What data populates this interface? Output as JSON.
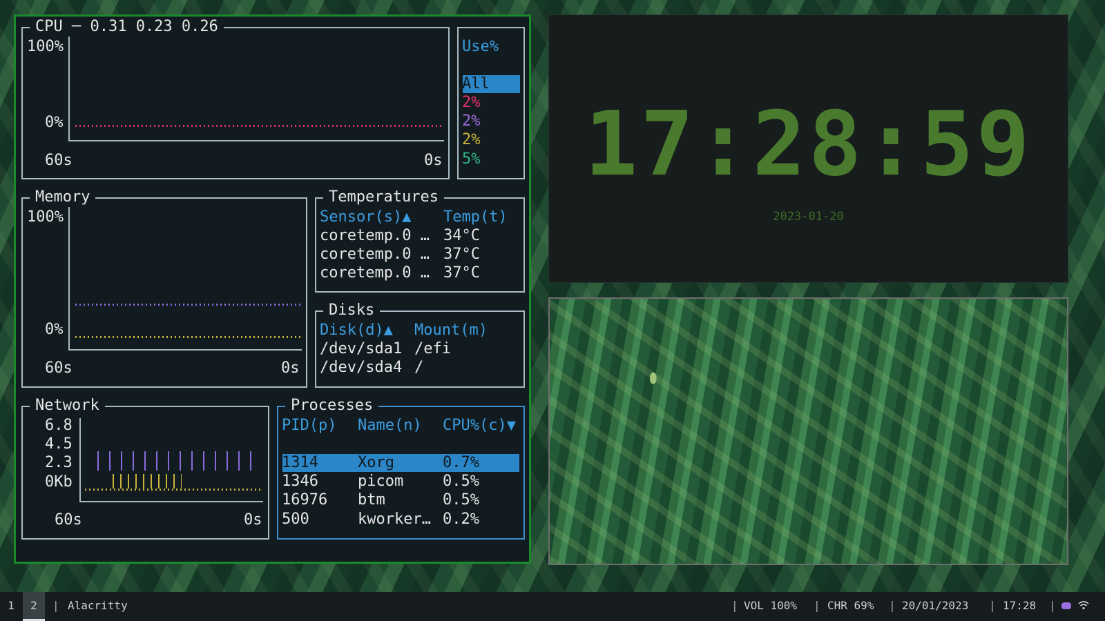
{
  "terminal": {
    "cpu": {
      "title": "CPU ─ 0.31 0.23 0.26",
      "y_top": "100%",
      "y_bottom": "0%",
      "x_left": "60s",
      "x_right": "0s",
      "legend_header": "Use%",
      "legend": [
        {
          "label": "All",
          "color": "#2b86c8",
          "selected": true
        },
        {
          "label": "2%",
          "color": "#e0306a"
        },
        {
          "label": "2%",
          "color": "#9a6ad8"
        },
        {
          "label": "2%",
          "color": "#c9b33a"
        },
        {
          "label": "5%",
          "color": "#2fb58a"
        }
      ]
    },
    "memory": {
      "title": "Memory",
      "y_top": "100%",
      "y_bottom": "0%",
      "x_left": "60s",
      "x_right": "0s"
    },
    "temperatures": {
      "title": "Temperatures",
      "col_sensor": "Sensor(s)▲",
      "col_temp": "Temp(t)",
      "rows": [
        {
          "sensor": "coretemp.0 …",
          "temp": "34°C"
        },
        {
          "sensor": "coretemp.0 …",
          "temp": "37°C"
        },
        {
          "sensor": "coretemp.0 …",
          "temp": "37°C"
        }
      ]
    },
    "disks": {
      "title": "Disks",
      "col_disk": "Disk(d)▲",
      "col_mount": "Mount(m)",
      "rows": [
        {
          "disk": "/dev/sda1",
          "mount": "/efi"
        },
        {
          "disk": "/dev/sda4",
          "mount": "/"
        }
      ]
    },
    "network": {
      "title": "Network",
      "y_ticks": [
        "6.8",
        "4.5",
        "2.3",
        "0Kb"
      ],
      "x_left": "60s",
      "x_right": "0s"
    },
    "processes": {
      "title": "Processes",
      "col_pid": "PID(p)",
      "col_name": "Name(n)",
      "col_cpu": "CPU%(c)▼",
      "rows": [
        {
          "pid": "1314",
          "name": "Xorg",
          "cpu": "0.7%",
          "selected": true
        },
        {
          "pid": "1346",
          "name": "picom",
          "cpu": "0.5%"
        },
        {
          "pid": "16976",
          "name": "btm",
          "cpu": "0.5%"
        },
        {
          "pid": "500",
          "name": "kworker…",
          "cpu": "0.2%"
        }
      ]
    }
  },
  "clock": {
    "time": "17:28:59",
    "date": "2023-01-20"
  },
  "bar": {
    "workspaces": [
      "1",
      "2"
    ],
    "active_workspace": "2",
    "window_title": "Alacritty",
    "volume": "VOL 100%",
    "charge": "CHR 69%",
    "date": "20/01/2023",
    "time": "17:28",
    "tray_icons": [
      "discord-icon",
      "wifi-icon"
    ]
  }
}
